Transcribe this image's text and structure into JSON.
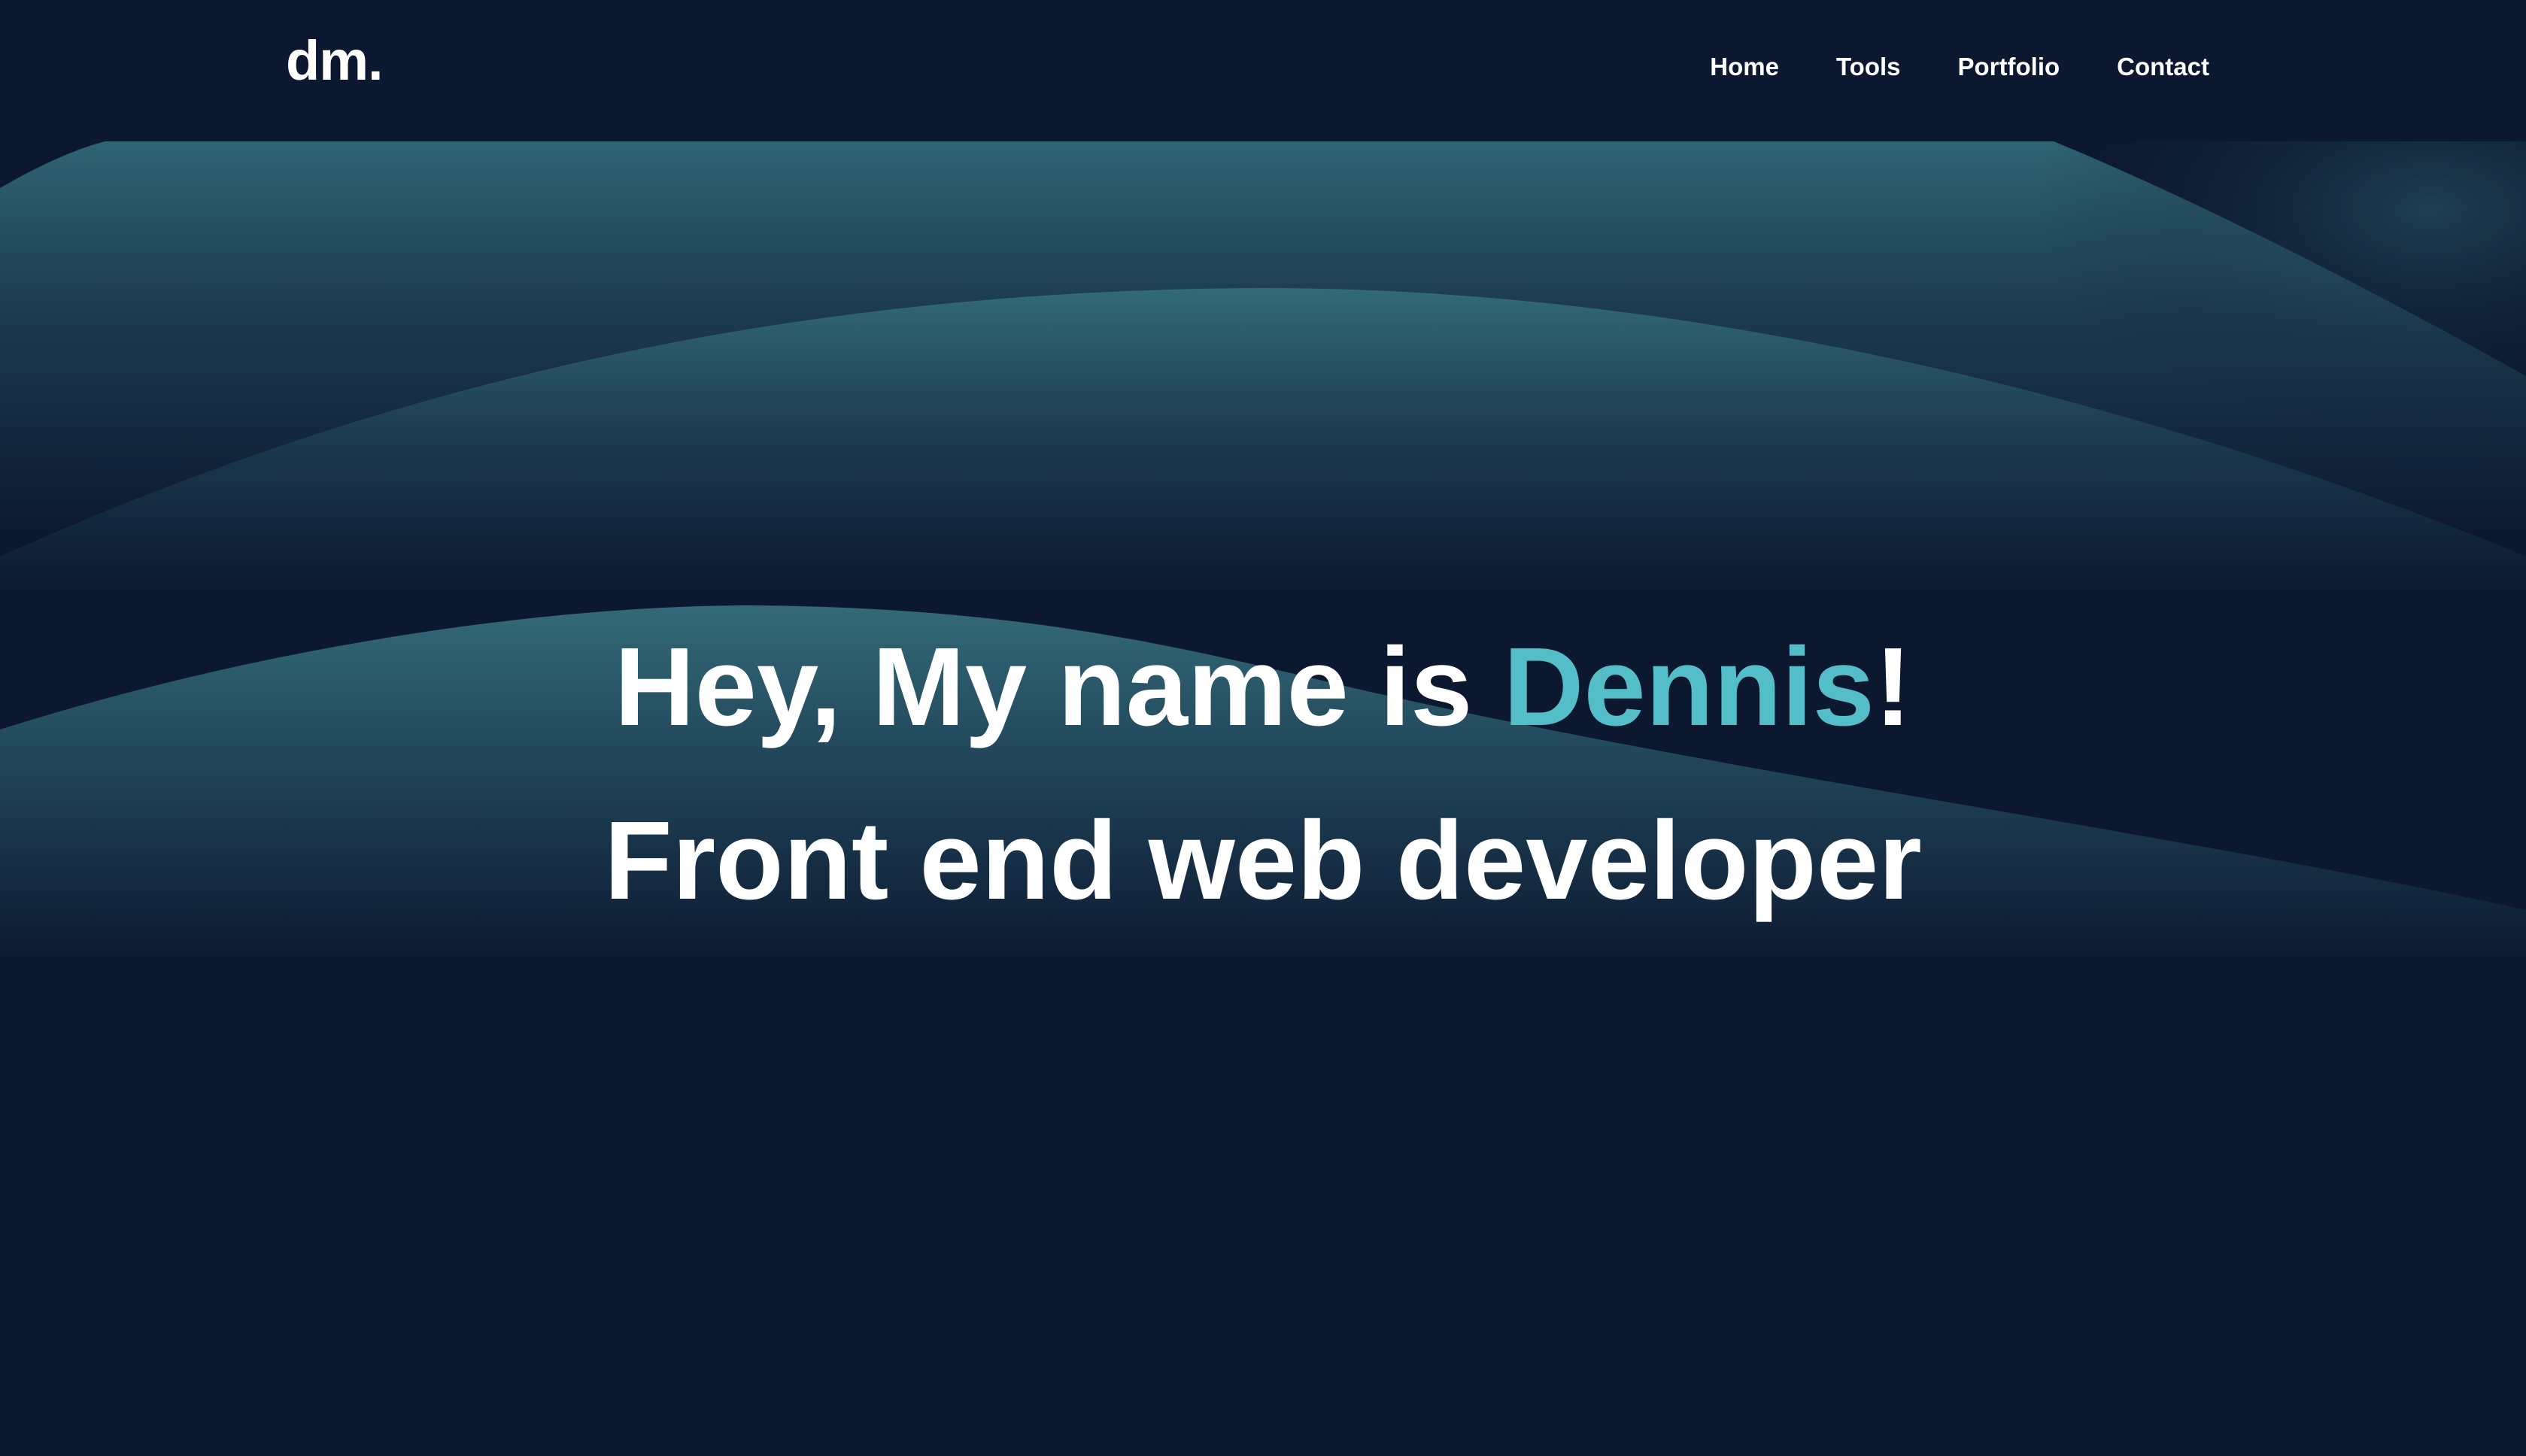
{
  "logo": {
    "text": "dm."
  },
  "nav": {
    "items": [
      {
        "label": "Home"
      },
      {
        "label": "Tools"
      },
      {
        "label": "Portfolio"
      },
      {
        "label": "Contact"
      }
    ]
  },
  "hero": {
    "greeting_prefix": "Hey, My name is ",
    "name": "Dennis",
    "greeting_suffix": "!",
    "subtitle": "Front end web developer"
  },
  "colors": {
    "background": "#0c1830",
    "accent": "#54bec8",
    "wave": "#2f6474",
    "text": "#ffffff"
  }
}
